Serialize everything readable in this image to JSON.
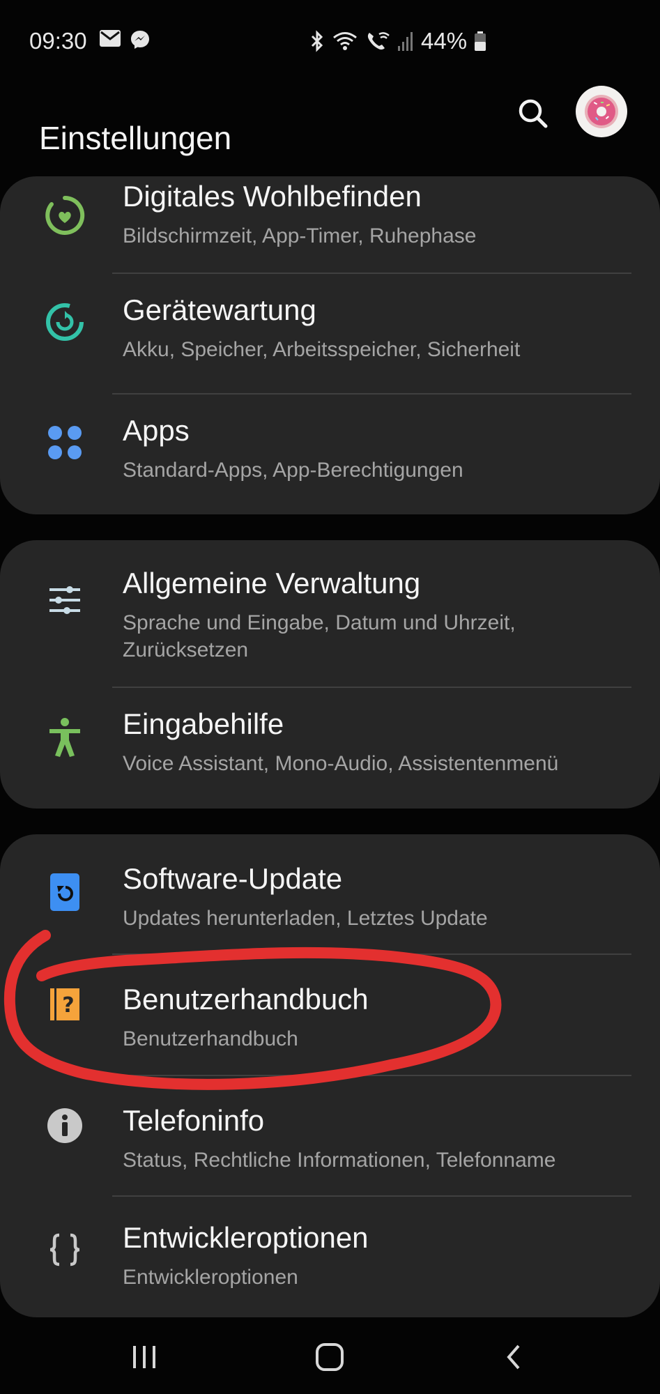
{
  "status_bar": {
    "time": "09:30",
    "left_icons": [
      "mail-icon",
      "messenger-icon"
    ],
    "right_icons": [
      "bluetooth-icon",
      "wifi-icon",
      "wifi-call-icon",
      "signal-icon",
      "battery-icon"
    ],
    "battery_text": "44%"
  },
  "header": {
    "title": "Einstellungen",
    "search_icon": "search-icon",
    "avatar_icon": "donut-avatar"
  },
  "groups": [
    {
      "items": [
        {
          "title": "Digitales Wohlbefinden",
          "subtitle": "Bildschirmzeit, App-Timer, Ruhephase",
          "icon": "digital-wellbeing-icon",
          "color": "#7fbf5c"
        },
        {
          "title": "Gerätewartung",
          "subtitle": "Akku, Speicher, Arbeitsspeicher, Sicherheit",
          "icon": "device-care-icon",
          "color": "#33c2a8"
        },
        {
          "title": "Apps",
          "subtitle": "Standard-Apps, App-Berechtigungen",
          "icon": "apps-icon",
          "color": "#5a9bf2"
        }
      ]
    },
    {
      "items": [
        {
          "title": "Allgemeine Verwaltung",
          "subtitle": "Sprache und Eingabe, Datum und Uhrzeit, Zurücksetzen",
          "icon": "sliders-icon",
          "color": "#c8dce6"
        },
        {
          "title": "Eingabehilfe",
          "subtitle": "Voice Assistant, Mono-Audio, Assistentenmenü",
          "icon": "accessibility-icon",
          "color": "#79c05d"
        }
      ]
    },
    {
      "items": [
        {
          "title": "Software-Update",
          "subtitle": "Updates herunterladen, Letztes Update",
          "icon": "software-update-icon",
          "color": "#3d8ff2"
        },
        {
          "title": "Benutzerhandbuch",
          "subtitle": "Benutzerhandbuch",
          "icon": "user-manual-icon",
          "color": "#f5a33b"
        },
        {
          "title": "Telefoninfo",
          "subtitle": "Status, Rechtliche Informationen, Telefonname",
          "icon": "info-icon",
          "color": "#c9c9c9"
        },
        {
          "title": "Entwickleroptionen",
          "subtitle": "Entwickleroptionen",
          "icon": "developer-braces-icon",
          "color": "#c9c9c9"
        }
      ]
    }
  ],
  "annotation": {
    "shape": "hand-drawn-circle",
    "color": "#e3302f",
    "target": "Benutzerhandbuch"
  },
  "nav_bar": {
    "icons": [
      "recent-apps-icon",
      "home-icon",
      "back-icon"
    ]
  }
}
